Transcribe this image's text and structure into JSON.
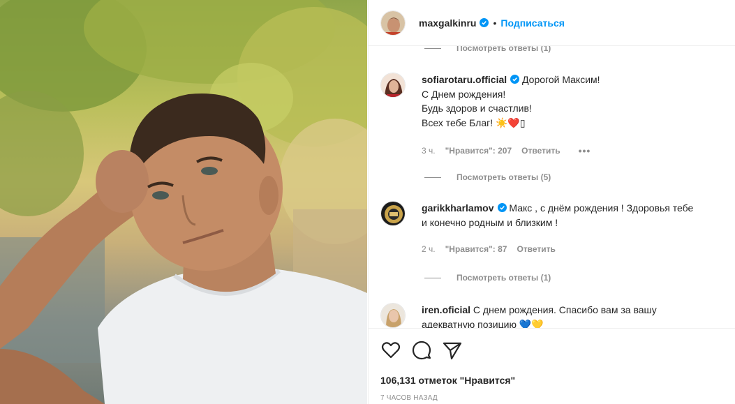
{
  "post": {
    "author": "maxgalkinru",
    "dot": "•",
    "follow_label": "Подписаться",
    "likes_text": "106,131 отметок \"Нравится\"",
    "timestamp": "7 ЧАСОВ НАЗАД"
  },
  "comments": {
    "top_view_replies": "Посмотреть ответы (1)",
    "items": [
      {
        "user": "sofiarotaru.official",
        "text_lines": [
          "Дорогой Максим!",
          "С Днем рождения!",
          "Будь здоров и счастлив!",
          "Всех тебе Благ! ☀️❤️▯"
        ],
        "time": "3 ч.",
        "likes": "\"Нравится\": 207",
        "reply_label": "Ответить",
        "more": "•••",
        "view_replies": "Посмотреть ответы (5)"
      },
      {
        "user": "garikkharlamov",
        "text_lines": [
          "Макс , с днём рождения ! Здоровья тебе",
          "и конечно родным и близким !"
        ],
        "time": "2 ч.",
        "likes": "\"Нравится\": 87",
        "reply_label": "Ответить",
        "view_replies": "Посмотреть ответы (1)"
      },
      {
        "user": "iren.oficial",
        "text_lines": [
          "С днем рождения. Спасибо вам за вашу",
          "адекватную позицию 💙💛"
        ]
      }
    ]
  },
  "icons": {
    "like": "heart-icon",
    "comment": "comment-bubble-icon",
    "share": "paper-plane-icon",
    "verified": "verified-badge-icon"
  },
  "colors": {
    "accent": "#0095f6",
    "text": "#262626",
    "muted": "#8e8e8e",
    "divider": "#efefef"
  }
}
